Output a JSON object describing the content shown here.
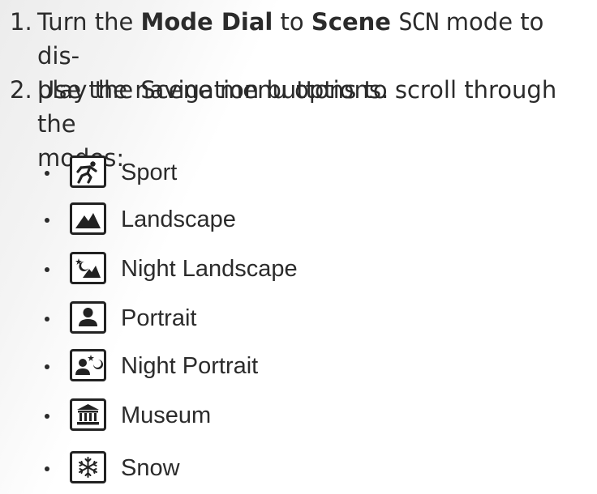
{
  "steps": [
    {
      "number": "1.",
      "parts": {
        "a": "Turn the ",
        "b": "Mode Dial",
        "c": " to ",
        "d": "Scene",
        "e": " ",
        "f": "SCN",
        "g": " mode to dis-",
        "h": "play the Scene menu options."
      }
    },
    {
      "number": "2.",
      "text_line_1": "Use the navigation buttons to scroll through the",
      "text_line_2": "modes:"
    }
  ],
  "modes": [
    {
      "label": "Sport",
      "icon": "sport-icon"
    },
    {
      "label": "Landscape",
      "icon": "landscape-icon"
    },
    {
      "label": "Night Landscape",
      "icon": "night-landscape-icon"
    },
    {
      "label": "Portrait",
      "icon": "portrait-icon"
    },
    {
      "label": "Night Portrait",
      "icon": "night-portrait-icon"
    },
    {
      "label": "Museum",
      "icon": "museum-icon"
    },
    {
      "label": "Snow",
      "icon": "snow-icon"
    }
  ]
}
